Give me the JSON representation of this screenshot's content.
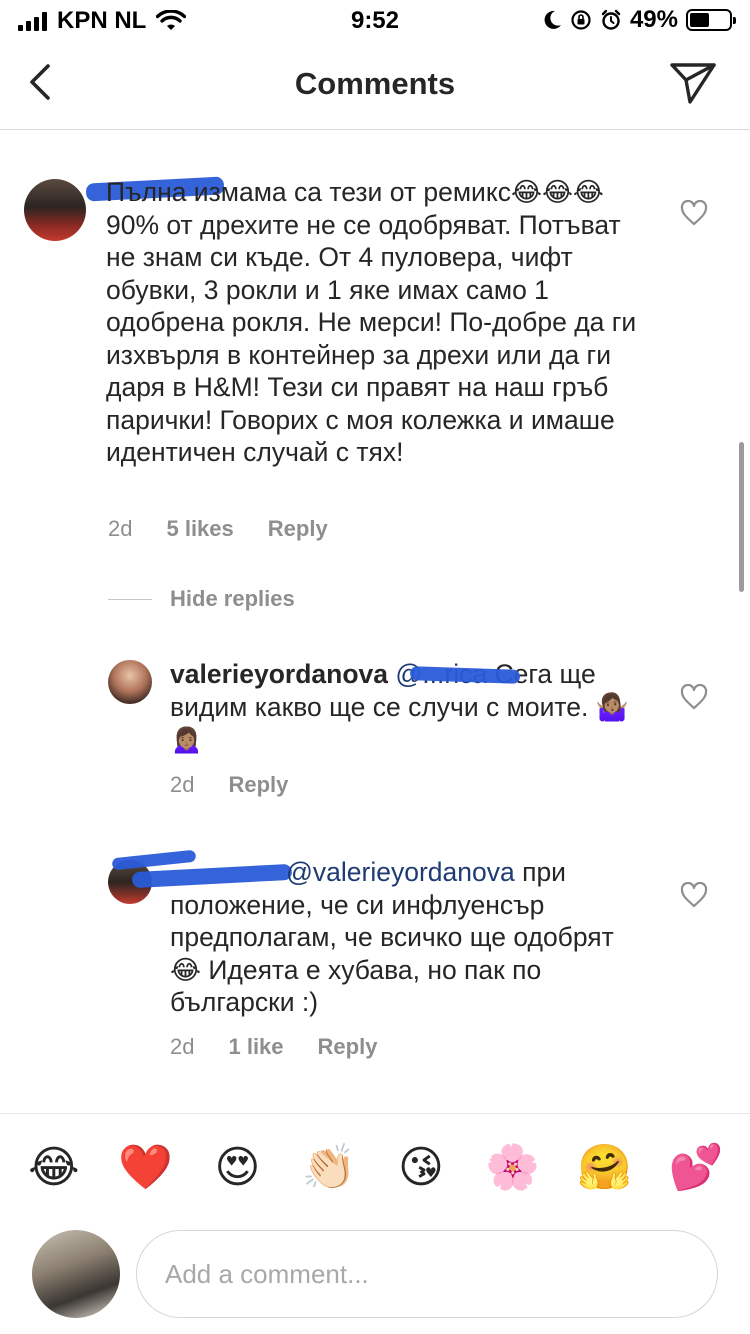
{
  "status_bar": {
    "carrier": "KPN NL",
    "time": "9:52",
    "battery": "49%",
    "battery_level": 0.49
  },
  "header": {
    "title": "Comments",
    "back_icon": "chevron-left-icon",
    "direct_icon": "paper-plane-icon"
  },
  "comments": [
    {
      "username": "",
      "text": "Пълна измама са тези от ремикс😂😂😂 90% от дрехите не се одобряват. Потъват не знам си къде. От 4 пуловера, чифт обувки, 3 рокли и 1 яке имах само 1 одобрена рокля. Не мерси! По-добре да ги изхвърля в контейнер за дрехи или да ги даря в H&M! Тези си правят на наш гръб парички! Говорих с моя колежка и имаше идентичен случай с тях!",
      "age": "2d",
      "likes": "5 likes",
      "reply": "Reply"
    }
  ],
  "hide_replies": "Hide replies",
  "replies": [
    {
      "username": "valerieyordanova",
      "mention": "@...rica",
      "text": "Сега ще видим какво ще се случи с моите. 🤷🏽‍♀️🙍🏽‍♀️",
      "age": "2d",
      "likes": "",
      "reply": "Reply"
    },
    {
      "username": "",
      "mention": "@valerieyordanova",
      "text": "при положение, че си инфлуенсър предполагам, че всичко ще одобрят 😂 Идеята е хубава, но пак по български :)",
      "age": "2d",
      "likes": "1 like",
      "reply": "Reply"
    }
  ],
  "emoji_bar": [
    "😂",
    "❤️",
    "😍",
    "👏🏻",
    "😘",
    "🌸",
    "🤗",
    "💕"
  ],
  "composer": {
    "placeholder": "Add a comment..."
  }
}
